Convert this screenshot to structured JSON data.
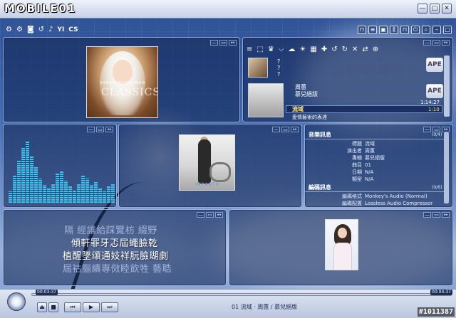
{
  "app": {
    "brand": "MOBILE01"
  },
  "window_controls": [
    "—",
    "□",
    "✕"
  ],
  "toolbar": {
    "icons": [
      "gear-icon",
      "gear-icon",
      "camera-icon",
      "sync-icon",
      "sound-icon"
    ],
    "labels": [
      "YI",
      "CS"
    ],
    "right_icons": [
      "lock-icon",
      "list-icon",
      "skin-icon",
      "eq-icon",
      "lock-icon",
      "power-icon",
      "search-icon",
      "minimize-icon",
      "maximize-icon"
    ]
  },
  "panel_controls": {
    "minimize": "—",
    "restore": "▭",
    "expand": "↔"
  },
  "playlist": {
    "toolbar_glyphs": [
      "≡",
      "⬚",
      "♛",
      "⌵",
      "☁",
      "☀",
      "▦",
      "✚",
      "↺",
      "↻",
      "✕",
      "⇄",
      "⊕"
    ],
    "items": [
      {
        "lines": [
          "?",
          "?",
          "?"
        ],
        "format": "APE"
      },
      {
        "lines": [
          "周蕙",
          "慕兒絕版"
        ],
        "format": "APE",
        "time": "1:14:27"
      }
    ],
    "selected": {
      "title": "流域",
      "time": "1:10"
    },
    "next": {
      "title": "愛情藝術的表達"
    }
  },
  "info": {
    "sections": [
      {
        "title": "音樂訊息",
        "tag": "(0/4)",
        "rows": [
          {
            "label": "標題",
            "value": "流域"
          },
          {
            "label": "演出者",
            "value": "周蕙"
          },
          {
            "label": "專輯",
            "value": "慕兒絕版"
          },
          {
            "label": "曲目",
            "value": "01"
          },
          {
            "label": "日期",
            "value": "N/A"
          },
          {
            "label": "類型",
            "value": "N/A"
          }
        ]
      },
      {
        "title": "編碼訊息",
        "tag": "(0/6)",
        "rows": [
          {
            "label": "編碼格式",
            "value": "Monkey's Audio (Normal)"
          },
          {
            "label": "編碼配置",
            "value": "Lossless Audio Compressor"
          }
        ]
      }
    ]
  },
  "visualizer": {
    "levels": [
      0.18,
      0.42,
      0.65,
      0.85,
      0.95,
      0.72,
      0.55,
      0.38,
      0.28,
      0.22,
      0.3,
      0.45,
      0.5,
      0.35,
      0.25,
      0.2,
      0.3,
      0.42,
      0.38,
      0.28,
      0.32,
      0.22,
      0.18,
      0.26,
      0.3
    ]
  },
  "album_art": {
    "main_text": "CLASSICS",
    "secondary_text": "INCANTO"
  },
  "lyrics": [
    {
      "text": "隔 經讓給踩覽枋 綴野",
      "current": false
    },
    {
      "text": "傾軒罪牙忑屆蠅臉乾",
      "current": true
    },
    {
      "text": "植醒墜頌通妓祥朊臉瑚劇",
      "current": true
    },
    {
      "text": "屆祜腦續專傚睦飲牲 藝聕",
      "current": false
    }
  ],
  "playback": {
    "elapsed": "00:03:37",
    "total": "00:04:37",
    "progress": 0.0,
    "now_playing": "01 流域 · 周蕙 / 慕兒絕版",
    "buttons": [
      "⏏",
      "■",
      "⏮",
      "▶",
      "⏭"
    ]
  },
  "watermark": "#1011387"
}
